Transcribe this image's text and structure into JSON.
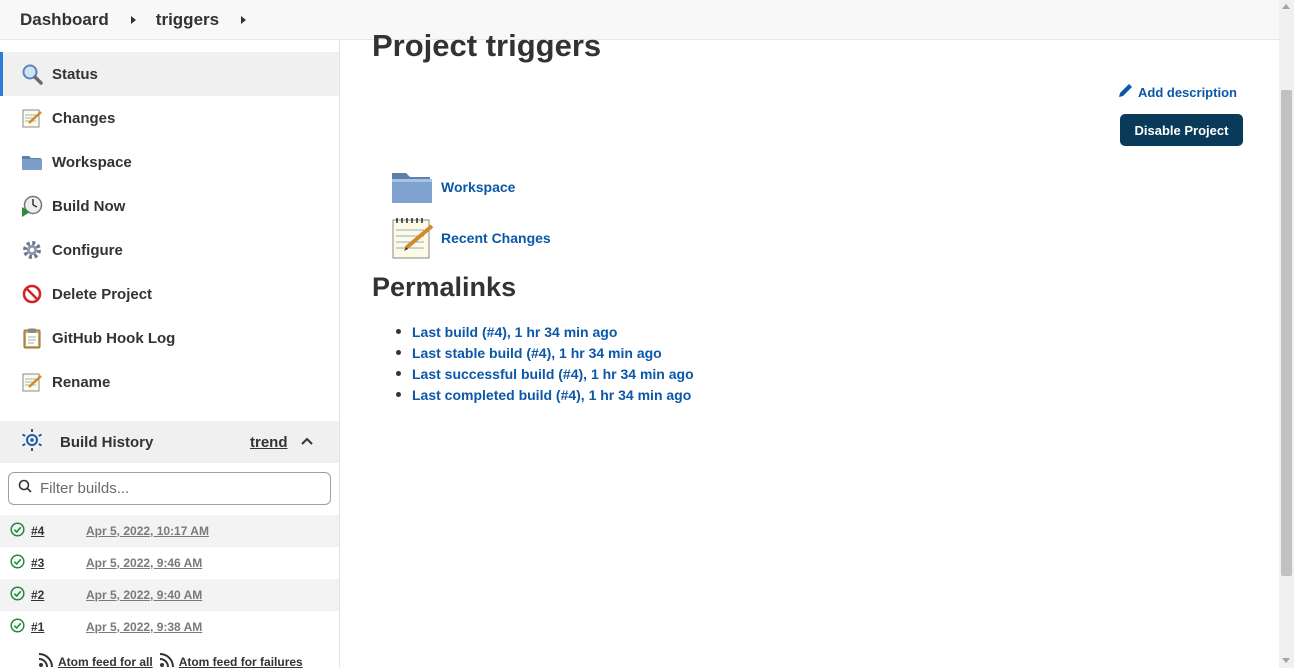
{
  "breadcrumb": {
    "items": [
      "Dashboard",
      "triggers"
    ]
  },
  "sidebar": {
    "tasks": [
      {
        "label": "Status",
        "icon": "search-icon",
        "active": true
      },
      {
        "label": "Changes",
        "icon": "notepad-icon"
      },
      {
        "label": "Workspace",
        "icon": "folder-icon"
      },
      {
        "label": "Build Now",
        "icon": "clock-play-icon"
      },
      {
        "label": "Configure",
        "icon": "gear-icon"
      },
      {
        "label": "Delete Project",
        "icon": "no-entry-icon"
      },
      {
        "label": "GitHub Hook Log",
        "icon": "clipboard-icon"
      },
      {
        "label": "Rename",
        "icon": "notepad-icon"
      }
    ]
  },
  "build_history": {
    "title": "Build History",
    "trend_label": "trend",
    "filter_placeholder": "Filter builds...",
    "builds": [
      {
        "number": "#4",
        "date": "Apr 5, 2022, 10:17 AM",
        "status": "success"
      },
      {
        "number": "#3",
        "date": "Apr 5, 2022, 9:46 AM",
        "status": "success"
      },
      {
        "number": "#2",
        "date": "Apr 5, 2022, 9:40 AM",
        "status": "success"
      },
      {
        "number": "#1",
        "date": "Apr 5, 2022, 9:38 AM",
        "status": "success"
      }
    ],
    "feeds": [
      "Atom feed for all",
      "Atom feed for failures"
    ]
  },
  "main": {
    "title": "Project triggers",
    "add_description": "Add description",
    "disable_button": "Disable Project",
    "links": [
      "Workspace",
      "Recent Changes"
    ],
    "permalinks_title": "Permalinks",
    "permalinks": [
      "Last build (#4), 1 hr 34 min ago",
      "Last stable build (#4), 1 hr 34 min ago",
      "Last successful build (#4), 1 hr 34 min ago",
      "Last completed build (#4), 1 hr 34 min ago"
    ]
  },
  "colors": {
    "link": "#0b57a8",
    "button_bg": "#0a3a5a",
    "success": "#1e8a3e",
    "active_bar": "#2c7bd6"
  }
}
